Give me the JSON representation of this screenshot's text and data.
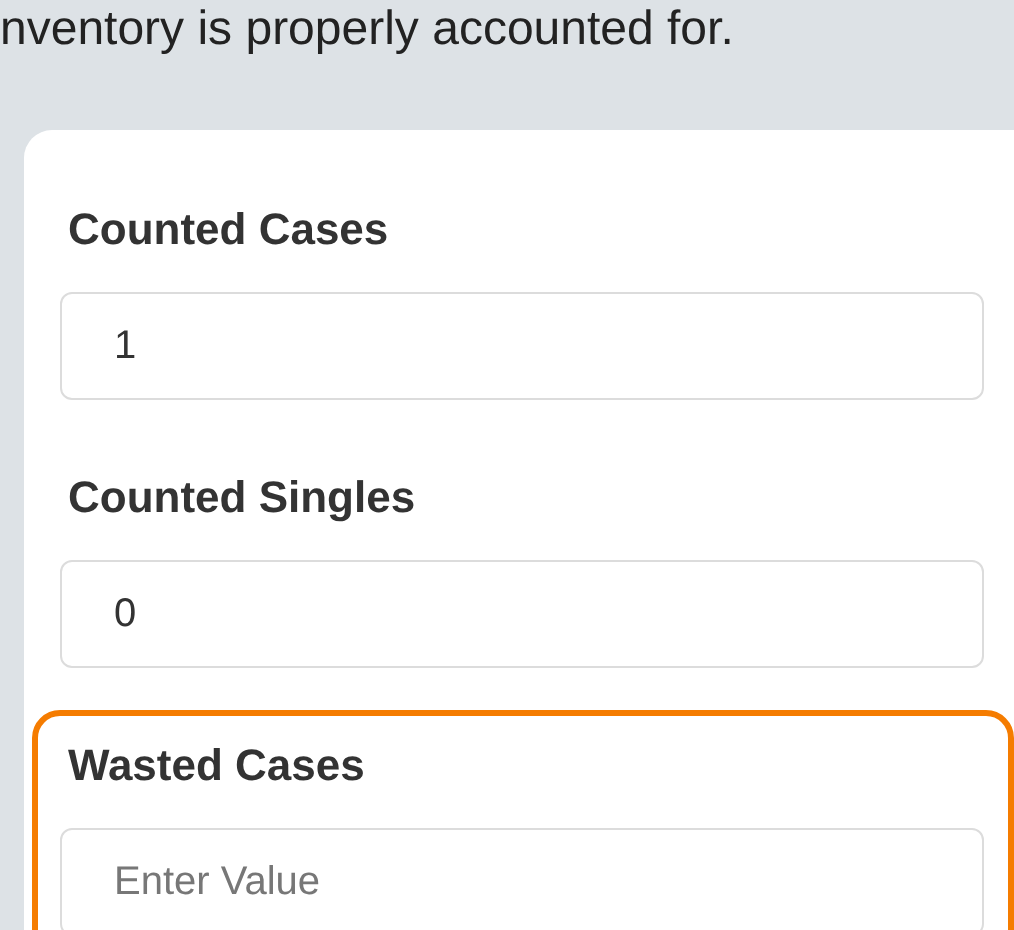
{
  "intro_text": "nventory is properly accounted for.",
  "fields": [
    {
      "label": "Counted Cases",
      "value": "1",
      "highlighted": false
    },
    {
      "label": "Counted Singles",
      "value": "0",
      "highlighted": false
    },
    {
      "label": "Wasted Cases",
      "placeholder": "Enter Value",
      "highlighted": true
    }
  ]
}
